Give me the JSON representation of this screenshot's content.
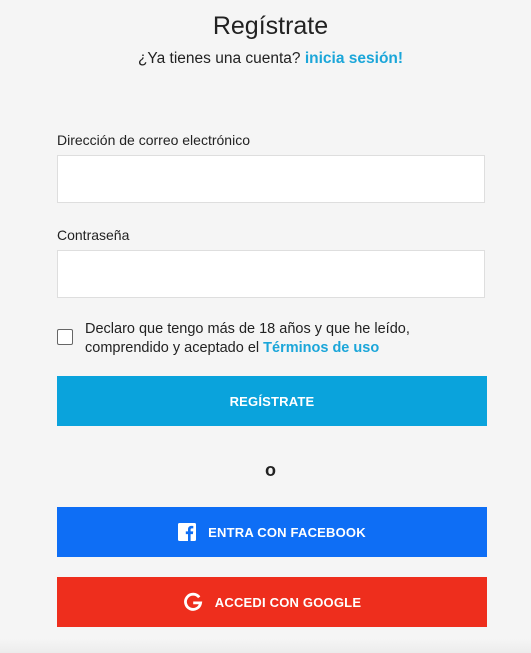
{
  "header": {
    "title": "Regístrate",
    "have_account_text": "¿Ya tienes una cuenta?",
    "login_link": "inicia sesión!"
  },
  "form": {
    "email_label": "Dirección de correo electrónico",
    "email_value": "",
    "password_label": "Contraseña",
    "password_value": "",
    "terms_text": "Declaro que tengo más de 18 años y que he leído, comprendido y aceptado el",
    "terms_link": "Términos de uso",
    "terms_checked": false,
    "register_button": "REGÍSTRATE"
  },
  "divider": {
    "text": "o"
  },
  "social": {
    "facebook_button": "ENTRA CON FACEBOOK",
    "google_button": "ACCEDI CON GOOGLE"
  },
  "colors": {
    "accent": "#1ba6d9",
    "register": "#0aa3dc",
    "facebook": "#0e6ef5",
    "google": "#ee2e1d"
  },
  "icons": {
    "facebook": "facebook-icon",
    "google": "google-icon"
  }
}
